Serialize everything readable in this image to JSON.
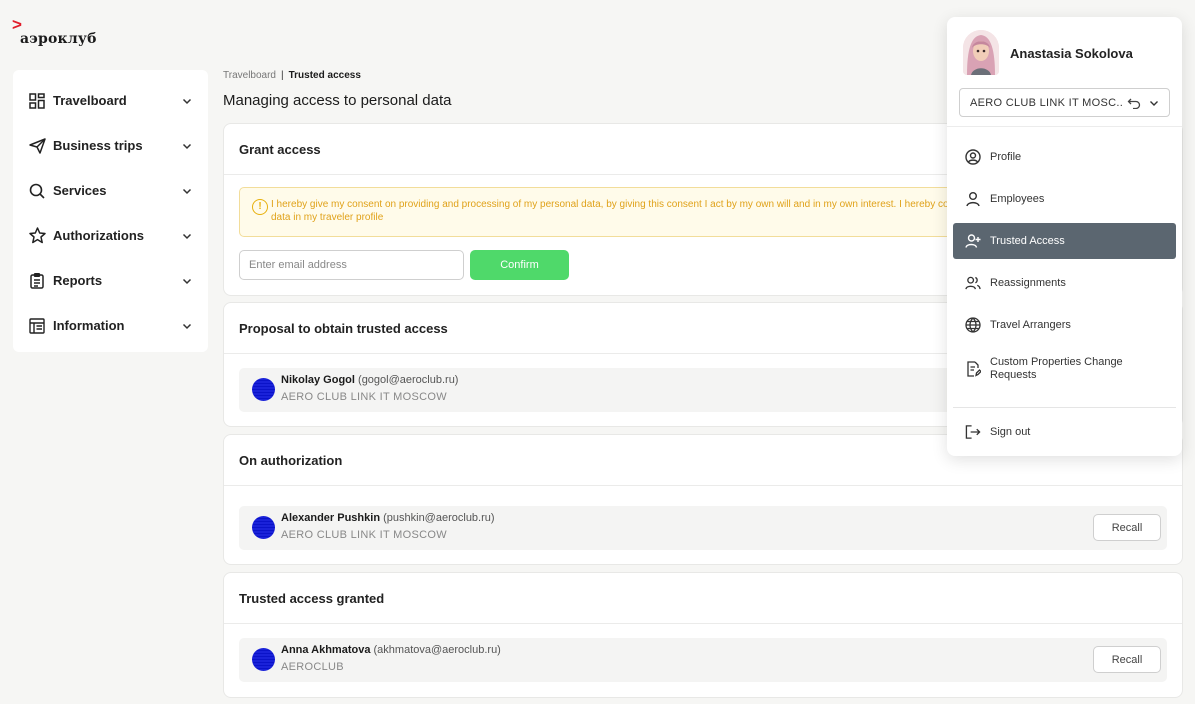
{
  "logo": {
    "text": "аэроклуб",
    "mark": ">"
  },
  "sidebar": {
    "items": [
      {
        "label": "Travelboard",
        "icon": "dashboard-icon"
      },
      {
        "label": "Business trips",
        "icon": "paper-plane-icon"
      },
      {
        "label": "Services",
        "icon": "search-icon"
      },
      {
        "label": "Authorizations",
        "icon": "star-icon"
      },
      {
        "label": "Reports",
        "icon": "clipboard-icon"
      },
      {
        "label": "Information",
        "icon": "info-grid-icon"
      }
    ]
  },
  "breadcrumb": {
    "parent": "Travelboard",
    "separator": "|",
    "current": "Trusted access"
  },
  "page": {
    "title": "Managing access to personal data"
  },
  "grant": {
    "title": "Grant access",
    "consent_text": "I hereby give my consent on providing and processing of my personal data, by giving this consent I act by my own will and in my own interest. I hereby consent to order services on my name and on my behalf, to view and to manage my personal data in my traveler profile",
    "email_placeholder": "Enter email address",
    "confirm_label": "Confirm"
  },
  "proposal": {
    "title": "Proposal to obtain trusted access",
    "person": {
      "name": "Nikolay Gogol",
      "email": "(gogol@aeroclub.ru)",
      "org": "AERO CLUB LINK IT MOSCOW"
    }
  },
  "authorization": {
    "title": "On authorization",
    "person": {
      "name": "Alexander Pushkin",
      "email": "(pushkin@aeroclub.ru)",
      "org": "AERO CLUB LINK IT MOSCOW"
    },
    "recall_label": "Recall"
  },
  "granted": {
    "title": "Trusted access granted",
    "person": {
      "name": "Anna Akhmatova",
      "email": "(akhmatova@aeroclub.ru)",
      "org": "AEROCLUB"
    },
    "recall_label": "Recall"
  },
  "dropdown": {
    "user_name": "Anastasia Sokolova",
    "company": "AERO CLUB LINK IT MOSC...",
    "menu": [
      {
        "label": "Profile",
        "icon": "user-circle-icon"
      },
      {
        "label": "Employees",
        "icon": "user-icon"
      },
      {
        "label": "Trusted Access",
        "icon": "user-plus-icon",
        "active": true
      },
      {
        "label": "Reassignments",
        "icon": "users-icon"
      },
      {
        "label": "Travel Arrangers",
        "icon": "globe-icon"
      },
      {
        "label": "Custom Properties Change Requests",
        "icon": "document-edit-icon"
      }
    ],
    "signout_label": "Sign out"
  },
  "colors": {
    "accent_green": "#4fd96a",
    "active_menu": "#5b6670",
    "warning": "#e8b10f",
    "brand_red": "#e11d2a"
  }
}
